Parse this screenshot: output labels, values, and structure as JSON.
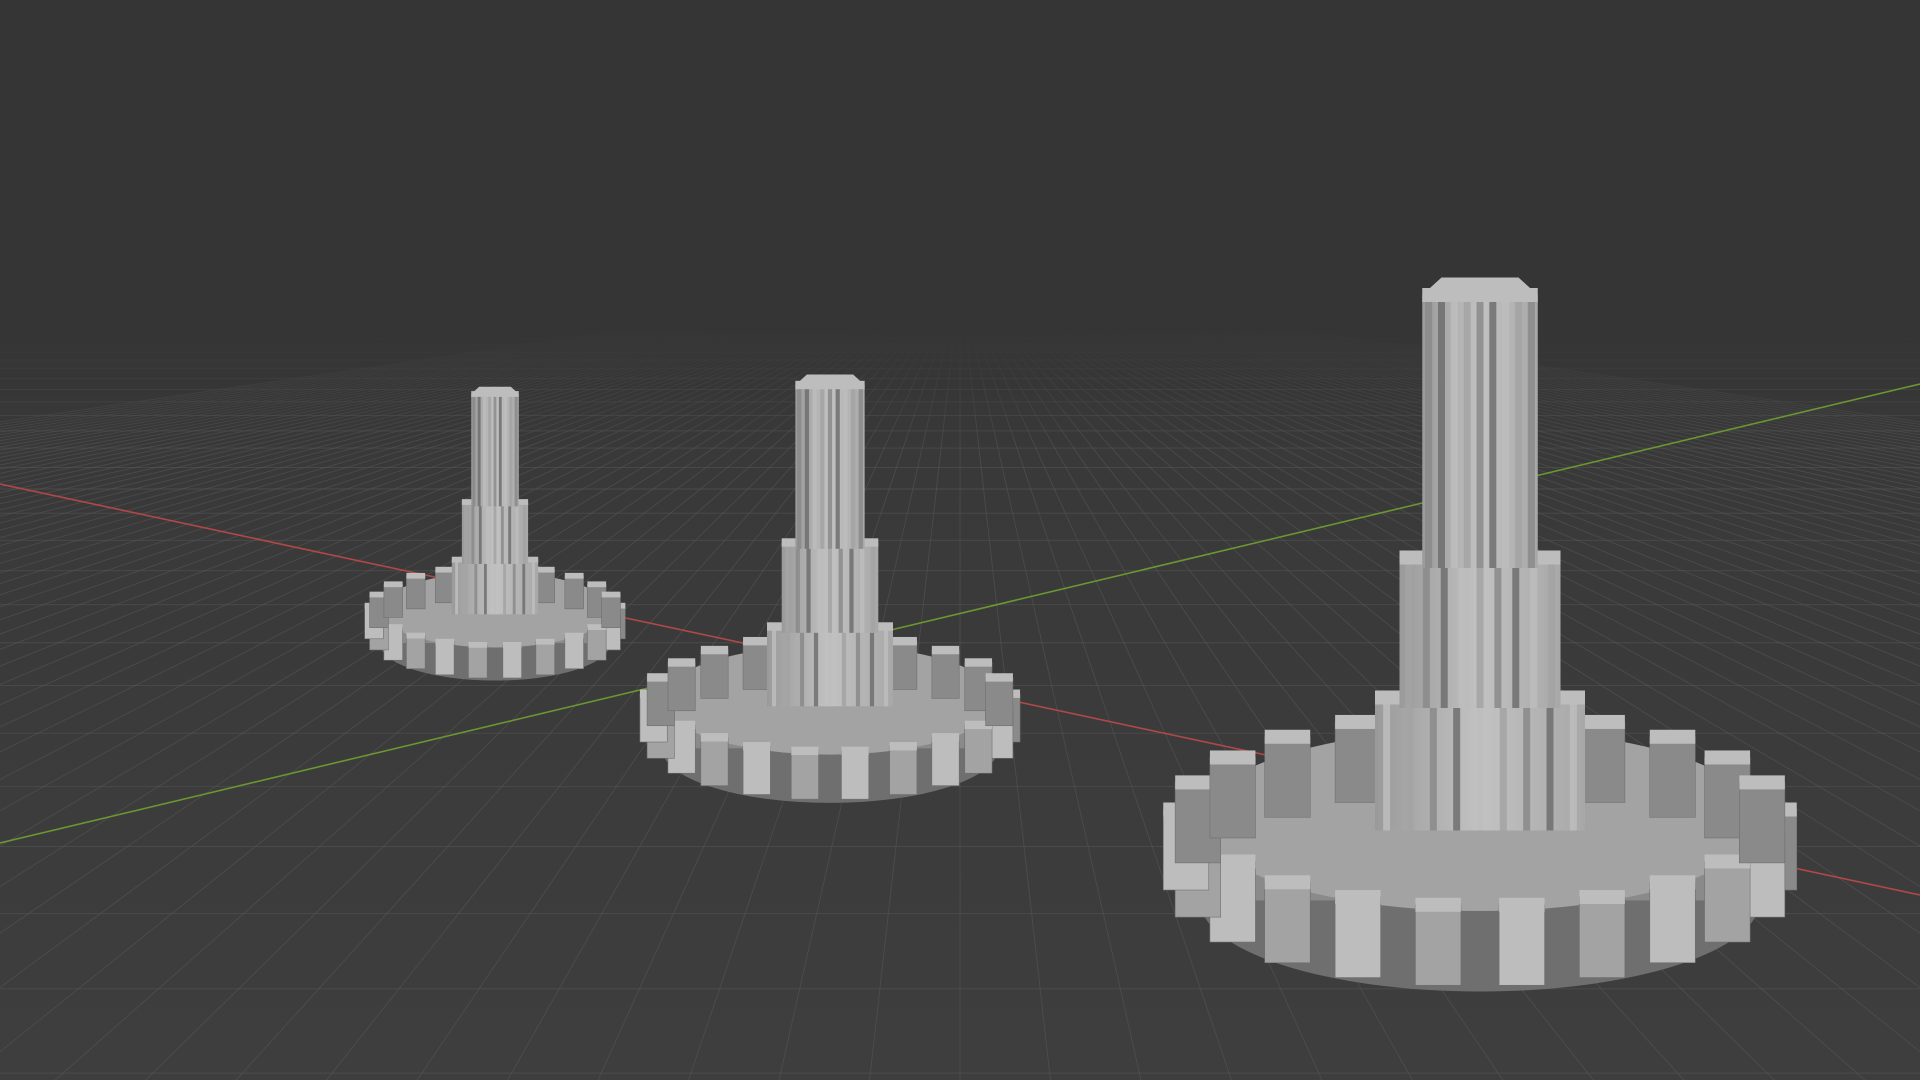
{
  "viewport": {
    "colors": {
      "background_top": "#353535",
      "background_bottom": "#3e3e3e",
      "grid_line": "#5a5a5a",
      "x_axis": "#b04848",
      "y_axis": "#6b9631",
      "mesh_light": "#bdbdbd",
      "mesh_mid": "#a3a3a3",
      "mesh_dark": "#8a8a8a",
      "mesh_shadow": "#6f6f6f"
    },
    "objects": [
      {
        "name": "gear-pinion-small"
      },
      {
        "name": "gear-pinion-medium"
      },
      {
        "name": "gear-pinion-large"
      }
    ]
  }
}
